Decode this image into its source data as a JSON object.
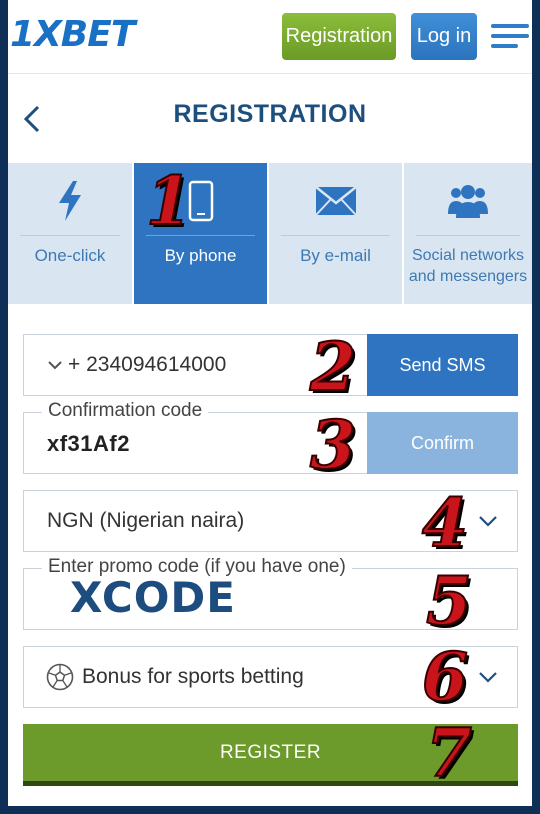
{
  "header": {
    "logo": "1XBET",
    "registration_button": "Registration",
    "login_button": "Log in"
  },
  "page": {
    "title": "REGISTRATION"
  },
  "tabs": [
    {
      "label": "One-click",
      "icon": "lightning-icon",
      "active": false
    },
    {
      "label": "By phone",
      "icon": "phone-icon",
      "active": true
    },
    {
      "label": "By e-mail",
      "icon": "envelope-icon",
      "active": false
    },
    {
      "label": "Social networks and messengers",
      "icon": "users-icon",
      "active": false
    }
  ],
  "form": {
    "phone": {
      "value": "+ 234094614000",
      "send_button": "Send SMS"
    },
    "confirmation": {
      "label": "Confirmation code",
      "value": "xf31Af2",
      "confirm_button": "Confirm"
    },
    "currency": {
      "value": "NGN (Nigerian naira)"
    },
    "promo": {
      "label": "Enter promo code (if you have one)",
      "value": "XCODE"
    },
    "bonus": {
      "value": "Bonus for sports betting"
    },
    "register_button": "REGISTER"
  },
  "steps": [
    "1",
    "2",
    "3",
    "4",
    "5",
    "6",
    "7"
  ],
  "colors": {
    "brand_blue": "#2f74c0",
    "brand_green": "#6c9b2b",
    "step_red": "#c8141a"
  }
}
